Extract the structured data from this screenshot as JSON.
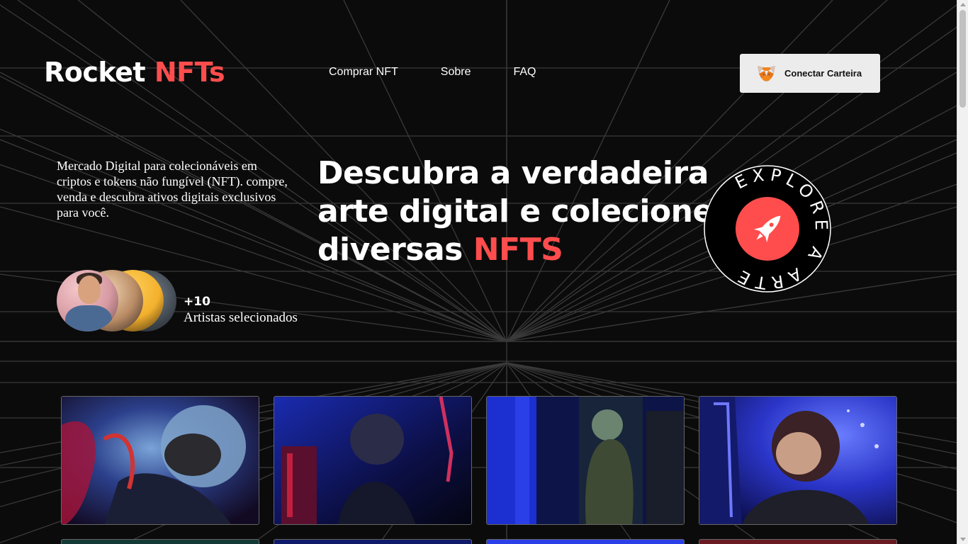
{
  "brand": {
    "name": "Rocket",
    "accent": "NFTs",
    "accent_color": "#ff4d4d"
  },
  "nav": {
    "items": [
      "Comprar NFT",
      "Sobre",
      "FAQ"
    ]
  },
  "wallet": {
    "label": "Conectar Carteira",
    "icon": "metamask-fox-icon"
  },
  "hero": {
    "intro": "Mercado Digital para colecionáveis em criptos e tokens não fungível (NFT). compre, venda e descubra ativos digitais exclusivos para você.",
    "headline": "Descubra a verdadeira arte digital e colecione diversas",
    "headline_accent": "NFTS",
    "artists": {
      "count": "+10",
      "label": "Artistas selecionados"
    },
    "badge": {
      "text": "EXPLORE A ARTE",
      "icon": "rocket-icon"
    }
  },
  "gallery": {
    "items": [
      {
        "name": "astronaut-red-helmet"
      },
      {
        "name": "astronaut-blue-corridor"
      },
      {
        "name": "astronaut-green-suit"
      },
      {
        "name": "astronaut-blue-lights"
      }
    ]
  },
  "colors": {
    "background": "#0b0b0b",
    "accent": "#ff4d4d",
    "button": "#ececec"
  }
}
